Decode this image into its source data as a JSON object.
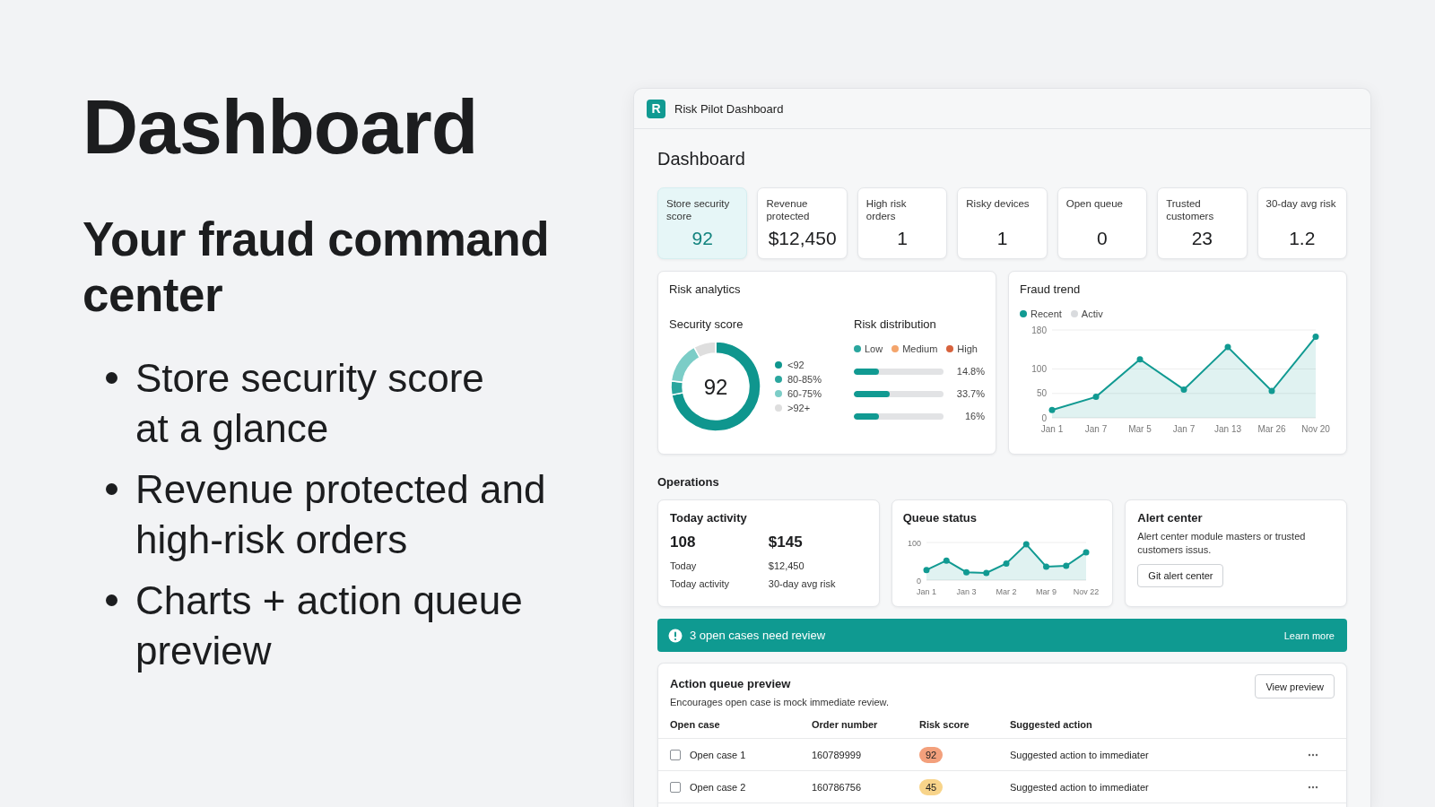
{
  "intro": {
    "title": "Dashboard",
    "subtitle": "Your fraud command center",
    "bullets": [
      "Store security score\nat a glance",
      "Revenue protected and\nhigh-risk orders",
      "Charts + action queue\npreview"
    ]
  },
  "window": {
    "title": "Risk Pilot Dashboard",
    "logo": "R"
  },
  "dashboard": {
    "heading": "Dashboard",
    "kpis": [
      {
        "label": "Store security score",
        "value": "92",
        "selected": true
      },
      {
        "label": "Revenue protected",
        "value": "$12,450",
        "selected": false
      },
      {
        "label": "High risk orders",
        "value": "1",
        "selected": false
      },
      {
        "label": "Risky devices",
        "value": "1",
        "selected": false
      },
      {
        "label": "Open queue",
        "value": "0",
        "selected": false
      },
      {
        "label": "Trusted customers",
        "value": "23",
        "selected": false
      },
      {
        "label": "30-day avg risk",
        "value": "1.2",
        "selected": false
      }
    ],
    "risk_analytics": {
      "title": "Risk analytics",
      "security": {
        "title": "Security score",
        "value": "92",
        "legend": [
          {
            "label": "<92",
            "color": "#0f968e"
          },
          {
            "label": "80-85%",
            "color": "#2aa69e"
          },
          {
            "label": "60-75%",
            "color": "#7ccdc7"
          },
          {
            "label": ">92+",
            "color": "#dedede"
          }
        ]
      },
      "distribution": {
        "title": "Risk distribution",
        "legend": [
          {
            "label": "Low",
            "color": "#2aa69e"
          },
          {
            "label": "Medium",
            "color": "#f4a56c"
          },
          {
            "label": "High",
            "color": "#d7623d"
          }
        ],
        "bars": [
          {
            "level": 0.28,
            "reading": "14.8%"
          },
          {
            "level": 0.4,
            "reading": "33.7%"
          },
          {
            "level": 0.28,
            "reading": "16%"
          }
        ]
      }
    },
    "fraud_trend": {
      "title": "Fraud trend",
      "legend": [
        {
          "label": "Activ",
          "color": "#d9dbde"
        }
      ],
      "chart_data": {
        "type": "area",
        "categories": [
          "Jan 1",
          "Jan 7",
          "Mar 5",
          "Jan 7",
          "Jan 13",
          "Mar 26",
          "Nov 20"
        ],
        "yticks": [
          0,
          50,
          100,
          180
        ],
        "ylim": [
          0,
          180
        ],
        "series": [
          {
            "name": "Recent",
            "color": "#119a92",
            "values": [
              16,
              43,
              120,
              58,
              145,
              55,
              166
            ]
          }
        ]
      }
    },
    "operations": {
      "title": "Operations",
      "today_activity": {
        "title": "Today activity",
        "columns": [
          {
            "value": "108",
            "lines": [
              "Today",
              "Today activity"
            ]
          },
          {
            "value": "$145",
            "lines": [
              "$12,450",
              "30-day avg risk"
            ]
          }
        ]
      },
      "queue_status": {
        "title": "Queue status",
        "chart_data": {
          "type": "area",
          "categories": [
            "Jan 1",
            null,
            "Jan 3",
            null,
            "Mar 2",
            null,
            "Mar 9",
            null,
            "Nov 22"
          ],
          "yticks": [
            0,
            100
          ],
          "ylim": [
            0,
            100
          ],
          "series": [
            {
              "color": "#119a92",
              "values": [
                27,
                52,
                21,
                19,
                44,
                95,
                36,
                38,
                74
              ]
            }
          ]
        }
      },
      "alert_center": {
        "title": "Alert center",
        "text": "Alert center module masters or trusted customers issus.",
        "button": "Git alert center"
      }
    },
    "banner": {
      "text": "3 open cases need review",
      "link": "Learn more"
    },
    "action_queue": {
      "title": "Action queue preview",
      "subtitle": "Encourages open case is mock immediate review.",
      "button": "View preview",
      "columns": [
        "Open case",
        "Order number",
        "Risk score",
        "Suggested action"
      ],
      "rows": [
        {
          "checked": false,
          "case": "Open case 1",
          "order": "160789999",
          "score": "92",
          "color": "#f3a07c",
          "action": "Suggested action to immediater"
        },
        {
          "checked": false,
          "case": "Open case 2",
          "order": "160786756",
          "score": "45",
          "color": "#f8d48a",
          "action": "Suggested action to immediater"
        }
      ]
    }
  }
}
